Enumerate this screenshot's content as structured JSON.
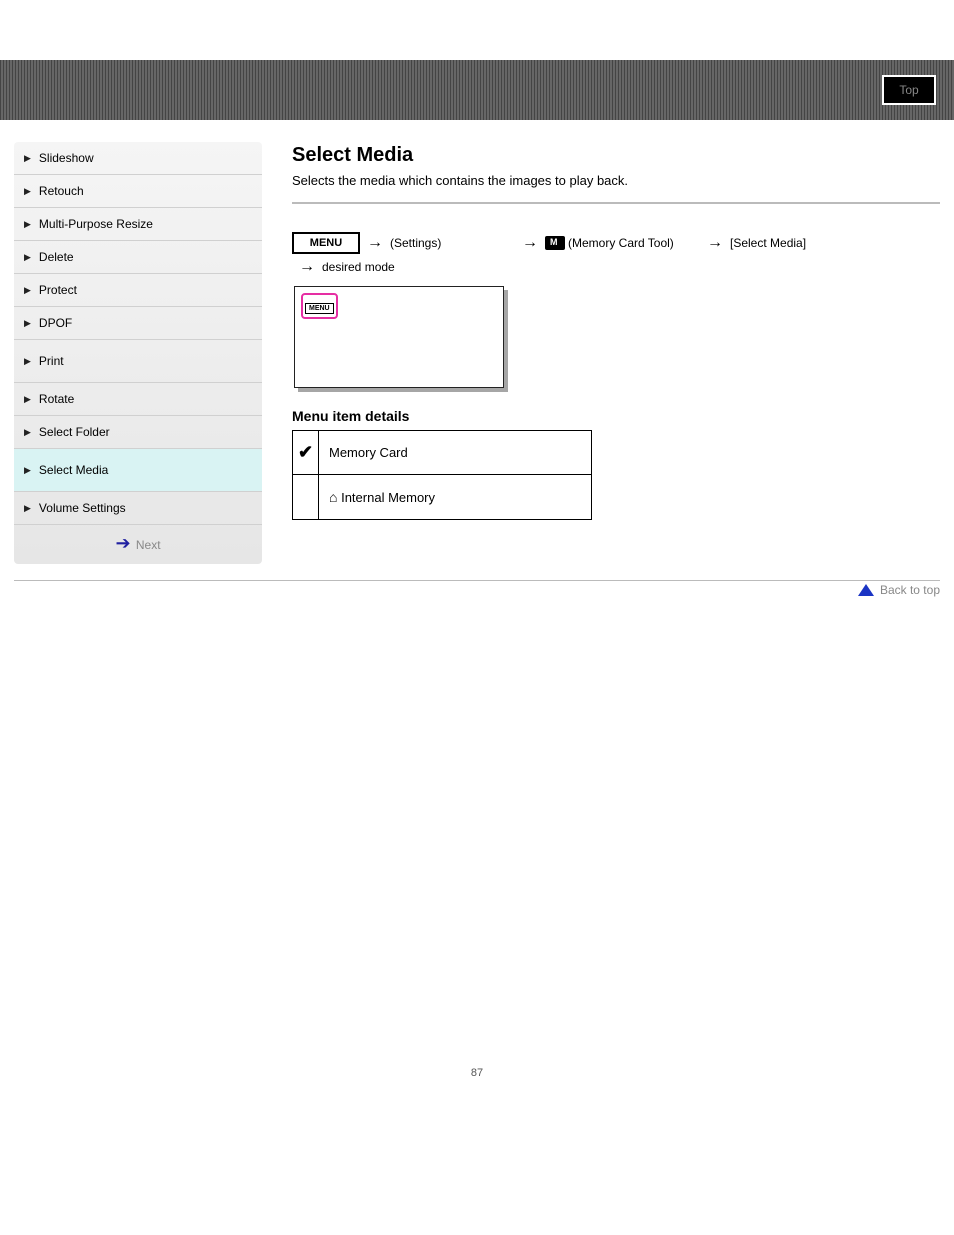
{
  "header": {
    "tab_label": "Top"
  },
  "sidebar": {
    "items": [
      {
        "label": "Slideshow"
      },
      {
        "label": "Retouch"
      },
      {
        "label": "Multi-Purpose Resize"
      },
      {
        "label": "Delete"
      },
      {
        "label": "Protect"
      },
      {
        "label": "DPOF"
      },
      {
        "label": "Print"
      },
      {
        "label": "Rotate"
      },
      {
        "label": "Select Folder"
      },
      {
        "label": "Select Media"
      },
      {
        "label": "Volume Settings"
      }
    ],
    "next": "Next"
  },
  "main": {
    "title": "Select Media",
    "subtitle": "Selects the media which contains the images to play back.",
    "menu_btn": "MENU",
    "path": {
      "step1": "(Settings)",
      "step2_label": "(Memory Card Tool)",
      "step3": "[Select Media]",
      "mode_suffix": "desired mode"
    },
    "options_heading": "Menu item details",
    "options": [
      {
        "check": true,
        "label": "Memory Card"
      },
      {
        "check": false,
        "label": "Internal Memory"
      }
    ],
    "back": "Back to top"
  },
  "page_number": "87"
}
